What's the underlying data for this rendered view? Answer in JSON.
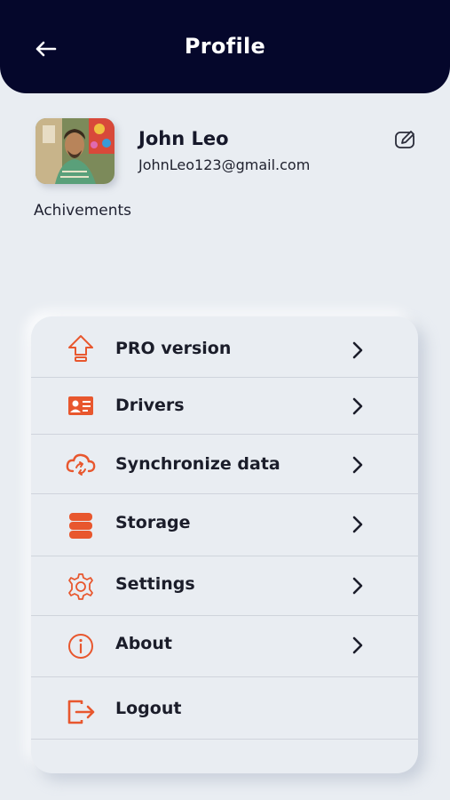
{
  "header": {
    "title": "Profile",
    "back_icon": "arrow-left-icon",
    "background": "#05072b"
  },
  "profile": {
    "name": "John Leo",
    "email": "JohnLeo123@gmail.com",
    "avatar": "user-photo",
    "edit_icon": "edit-pencil-icon"
  },
  "achievements_label": "Achivements",
  "menu": {
    "accent_color": "#e8572e",
    "items": [
      {
        "label": "PRO version",
        "icon": "upload-arrow-icon",
        "chevron": true
      },
      {
        "label": "Drivers",
        "icon": "id-card-icon",
        "chevron": true
      },
      {
        "label": "Synchronize data",
        "icon": "cloud-sync-icon",
        "chevron": true
      },
      {
        "label": "Storage",
        "icon": "database-icon",
        "chevron": true
      },
      {
        "label": "Settings",
        "icon": "gear-icon",
        "chevron": true
      },
      {
        "label": "About",
        "icon": "info-icon",
        "chevron": true
      },
      {
        "label": "Logout",
        "icon": "logout-icon",
        "chevron": false
      }
    ]
  }
}
